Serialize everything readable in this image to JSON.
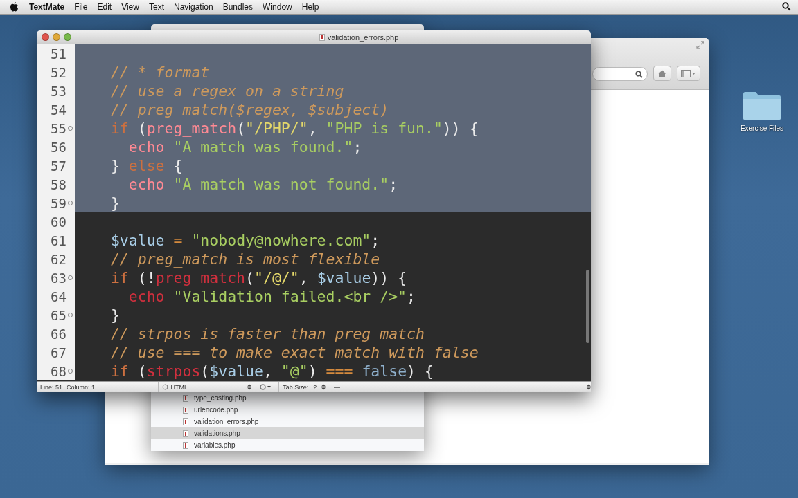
{
  "menu_bar": {
    "items": [
      {
        "label": "TextMate",
        "kind": "app"
      },
      {
        "label": "File",
        "kind": "menu"
      },
      {
        "label": "Edit",
        "kind": "menu"
      },
      {
        "label": "View",
        "kind": "menu"
      },
      {
        "label": "Text",
        "kind": "menu"
      },
      {
        "label": "Navigation",
        "kind": "menu"
      },
      {
        "label": "Bundles",
        "kind": "menu"
      },
      {
        "label": "Window",
        "kind": "menu"
      },
      {
        "label": "Help",
        "kind": "menu"
      }
    ]
  },
  "desktop_icons": [
    {
      "label": "Exercise Files"
    }
  ],
  "file_window": {
    "files": [
      {
        "name": "type_casting.php",
        "selected": false
      },
      {
        "name": "urlencode.php",
        "selected": false
      },
      {
        "name": "validation_errors.php",
        "selected": false
      },
      {
        "name": "validations.php",
        "selected": true
      },
      {
        "name": "variables.php",
        "selected": false
      }
    ]
  },
  "editor": {
    "title": "validation_errors.php",
    "lines": [
      {
        "number": "51",
        "selected": true,
        "fold": false
      },
      {
        "number": "52",
        "selected": true,
        "fold": false,
        "tokens": [
          {
            "kind": "comment",
            "text": "  // * format"
          }
        ]
      },
      {
        "number": "53",
        "selected": true,
        "fold": false,
        "tokens": [
          {
            "kind": "comment",
            "text": "  // use a regex on a string"
          }
        ]
      },
      {
        "number": "54",
        "selected": true,
        "fold": false,
        "tokens": [
          {
            "kind": "comment",
            "text": "  // preg_match($regex, $subject)"
          }
        ]
      },
      {
        "number": "55",
        "selected": true,
        "fold": true,
        "tokens": [
          {
            "kind": "keyword",
            "text": "  if"
          },
          {
            "kind": "plain",
            "text": " ("
          },
          {
            "kind": "function",
            "text": "preg_match"
          },
          {
            "kind": "plain",
            "text": "("
          },
          {
            "kind": "regex",
            "text": "\"/PHP/\""
          },
          {
            "kind": "plain",
            "text": ", "
          },
          {
            "kind": "string",
            "text": "\"PHP is fun.\""
          },
          {
            "kind": "plain",
            "text": ")) {"
          }
        ]
      },
      {
        "number": "56",
        "selected": true,
        "fold": false,
        "tokens": [
          {
            "kind": "function",
            "text": "    echo"
          },
          {
            "kind": "string",
            "text": " \"A match was found.\""
          },
          {
            "kind": "plain",
            "text": ";"
          }
        ]
      },
      {
        "number": "57",
        "selected": true,
        "fold": false,
        "tokens": [
          {
            "kind": "plain",
            "text": "  } "
          },
          {
            "kind": "keyword",
            "text": "else"
          },
          {
            "kind": "plain",
            "text": " {"
          }
        ]
      },
      {
        "number": "58",
        "selected": true,
        "fold": false,
        "tokens": [
          {
            "kind": "function",
            "text": "    echo"
          },
          {
            "kind": "string",
            "text": " \"A match was not found.\""
          },
          {
            "kind": "plain",
            "text": ";"
          }
        ]
      },
      {
        "number": "59",
        "selected": true,
        "fold": true,
        "tokens": [
          {
            "kind": "plain",
            "text": "  }"
          }
        ]
      },
      {
        "number": "60",
        "selected": false,
        "fold": false
      },
      {
        "number": "61",
        "selected": false,
        "fold": false,
        "tokens": [
          {
            "kind": "variable",
            "text": "  $value"
          },
          {
            "kind": "operator",
            "text": " = "
          },
          {
            "kind": "string",
            "text": "\"nobody@nowhere.com\""
          },
          {
            "kind": "plain",
            "text": ";"
          }
        ]
      },
      {
        "number": "62",
        "selected": false,
        "fold": false,
        "tokens": [
          {
            "kind": "comment",
            "text": "  // preg_match is most flexible"
          }
        ]
      },
      {
        "number": "63",
        "selected": false,
        "fold": true,
        "tokens": [
          {
            "kind": "keyword",
            "text": "  if"
          },
          {
            "kind": "plain",
            "text": " (!"
          },
          {
            "kind": "function",
            "text": "preg_match"
          },
          {
            "kind": "plain",
            "text": "("
          },
          {
            "kind": "regex",
            "text": "\"/@/\""
          },
          {
            "kind": "plain",
            "text": ", "
          },
          {
            "kind": "variable",
            "text": "$value"
          },
          {
            "kind": "plain",
            "text": ")) {"
          }
        ]
      },
      {
        "number": "64",
        "selected": false,
        "fold": false,
        "tokens": [
          {
            "kind": "function",
            "text": "    echo"
          },
          {
            "kind": "string",
            "text": " \"Validation failed.<br />\""
          },
          {
            "kind": "plain",
            "text": ";"
          }
        ]
      },
      {
        "number": "65",
        "selected": false,
        "fold": true,
        "tokens": [
          {
            "kind": "plain",
            "text": "  }"
          }
        ]
      },
      {
        "number": "66",
        "selected": false,
        "fold": false,
        "tokens": [
          {
            "kind": "comment",
            "text": "  // strpos is faster than preg_match"
          }
        ]
      },
      {
        "number": "67",
        "selected": false,
        "fold": false,
        "tokens": [
          {
            "kind": "comment",
            "text": "  // use === to make exact match with false"
          }
        ]
      },
      {
        "number": "68",
        "selected": false,
        "fold": true,
        "tokens": [
          {
            "kind": "keyword",
            "text": "  if"
          },
          {
            "kind": "plain",
            "text": " ("
          },
          {
            "kind": "function",
            "text": "strpos"
          },
          {
            "kind": "plain",
            "text": "("
          },
          {
            "kind": "variable",
            "text": "$value"
          },
          {
            "kind": "plain",
            "text": ", "
          },
          {
            "kind": "string",
            "text": "\"@\""
          },
          {
            "kind": "plain",
            "text": ") "
          },
          {
            "kind": "operator",
            "text": "==="
          },
          {
            "kind": "constant",
            "text": " false"
          },
          {
            "kind": "plain",
            "text": ") {"
          }
        ]
      }
    ]
  },
  "status_bar": {
    "line": "Line: 51",
    "column": "Column: 1",
    "syntax": "HTML",
    "tab_size_label": "Tab Size:",
    "tab_size": "2",
    "symbol": "—"
  }
}
